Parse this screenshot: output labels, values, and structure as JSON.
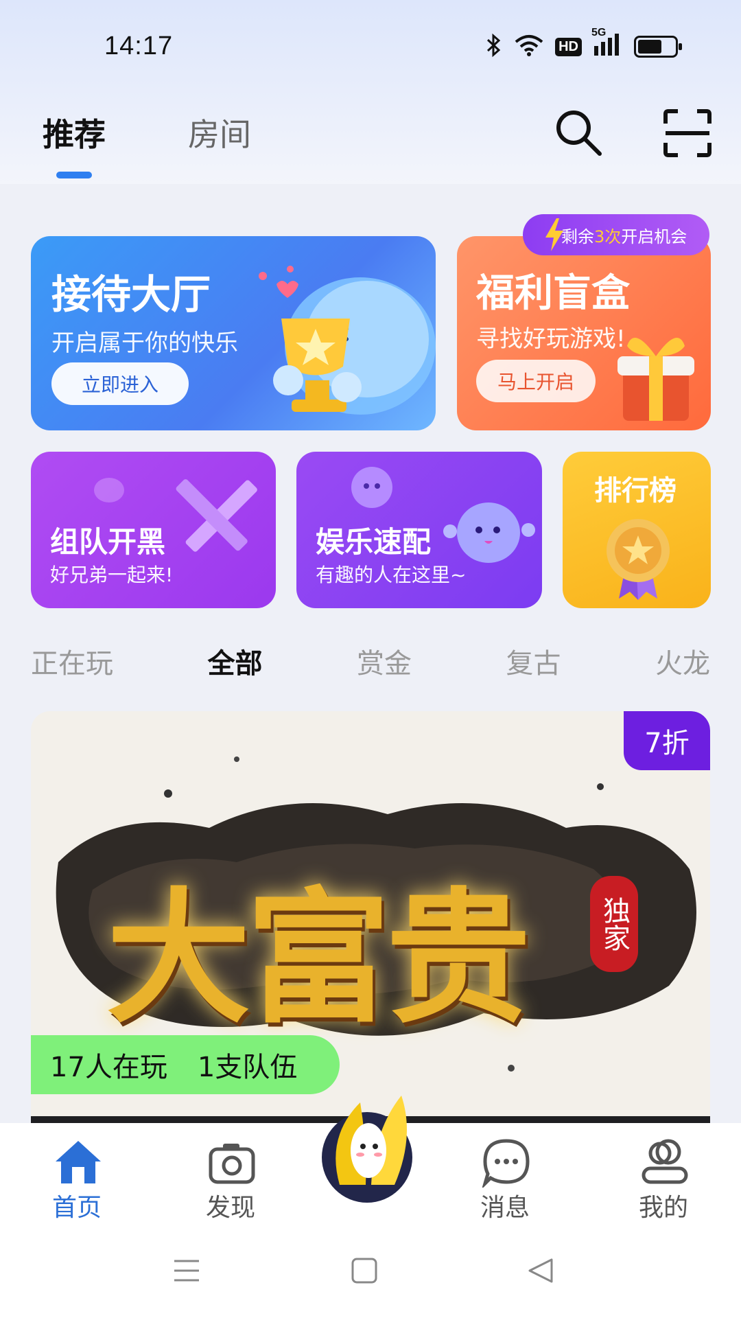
{
  "status_bar": {
    "time": "14:17",
    "network": "5G",
    "hd_label": "HD",
    "icons": [
      "bluetooth-icon",
      "wifi-icon",
      "hd-icon",
      "signal-icon",
      "battery-icon"
    ]
  },
  "top_tabs": [
    {
      "label": "推荐",
      "active": true
    },
    {
      "label": "房间",
      "active": false
    }
  ],
  "header_icons": [
    "search-icon",
    "scan-icon"
  ],
  "banners": {
    "reception": {
      "title": "接待大厅",
      "subtitle": "开启属于你的快乐",
      "button": "立即进入"
    },
    "blind_box": {
      "title": "福利盲盒",
      "subtitle": "寻找好玩游戏!",
      "button": "马上开启",
      "badge_prefix": "剩余",
      "badge_count": "3次",
      "badge_suffix": "开启机会"
    },
    "team": {
      "title": "组队开黑",
      "subtitle": "好兄弟一起来!"
    },
    "entertainment": {
      "title": "娱乐速配",
      "subtitle": "有趣的人在这里~"
    },
    "ranking": {
      "title": "排行榜"
    }
  },
  "category_tabs": [
    {
      "label": "正在玩",
      "active": false
    },
    {
      "label": "全部",
      "active": true
    },
    {
      "label": "赏金",
      "active": false
    },
    {
      "label": "复古",
      "active": false
    },
    {
      "label": "火龙",
      "active": false
    }
  ],
  "game_card": {
    "logo_text": "大富贵",
    "seal_text": "独家",
    "discount": "7折",
    "players": "17人在玩",
    "teams": "1支队伍"
  },
  "bottom_nav": [
    {
      "label": "首页",
      "icon": "home-icon",
      "active": true
    },
    {
      "label": "发现",
      "icon": "camera-icon",
      "active": false
    },
    {
      "label": "消息",
      "icon": "chat-icon",
      "active": false
    },
    {
      "label": "我的",
      "icon": "profile-icon",
      "active": false
    }
  ],
  "colors": {
    "accent": "#2f7ff0",
    "reception_bg": "#4a8cf5",
    "blindbox_bg": "#ff6a3c",
    "team_bg": "#a845f2",
    "ent_bg": "#853ff2",
    "rank_bg": "#fbbd27",
    "discount_bg": "#6d1fe0",
    "players_bg": "#7ff07a"
  }
}
